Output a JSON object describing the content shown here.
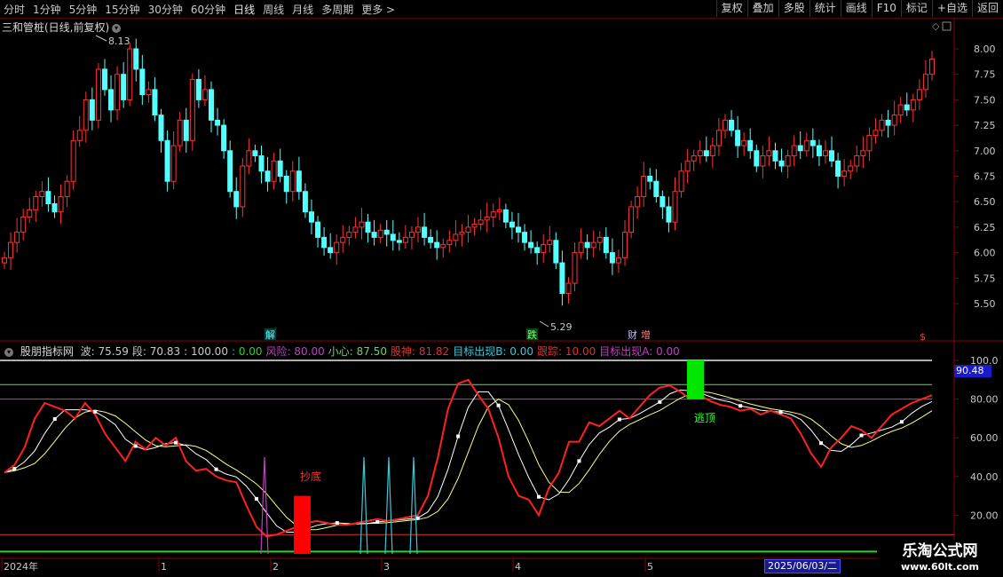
{
  "toolbar": {
    "periods": [
      "分时",
      "1分钟",
      "5分钟",
      "15分钟",
      "30分钟",
      "60分钟",
      "日线",
      "周线",
      "月线",
      "多周期",
      "更多 >"
    ],
    "active_period": "日线",
    "tools": [
      "复权",
      "叠加",
      "多股",
      "统计",
      "画线",
      "F10",
      "标记",
      "+自选",
      "返回"
    ]
  },
  "chart": {
    "stock_title": "三和管桩(日线,前复权)",
    "high_label": "8.13",
    "low_label": "5.29",
    "price_ticks": [
      "8.00",
      "7.75",
      "7.50",
      "7.25",
      "7.00",
      "6.75",
      "6.50",
      "6.25",
      "6.00",
      "5.75",
      "5.50"
    ],
    "price_range": [
      5.29,
      8.13
    ],
    "markers": [
      "解",
      "跌",
      "财",
      "增",
      "$"
    ]
  },
  "indicator": {
    "name": "股朋指标网",
    "values": [
      {
        "label": "波:",
        "value": "75.59",
        "color": "#c8c8c8"
      },
      {
        "label": "段:",
        "value": "70.83",
        "color": "#c8c8c8"
      },
      {
        "label": ":",
        "value": "100.00",
        "color": "#c8c8c8"
      },
      {
        "label": ":",
        "value": "0.00",
        "color": "#27d427"
      },
      {
        "label": "风险:",
        "value": "80.00",
        "color": "#c040c0"
      },
      {
        "label": "小心:",
        "value": "87.50",
        "color": "#6ad36a"
      },
      {
        "label": "股神:",
        "value": "81.82",
        "color": "#e03030"
      },
      {
        "label": "目标出现B:",
        "value": "0.00",
        "color": "#38c8d8"
      },
      {
        "label": "跟踪:",
        "value": "10.00",
        "color": "#e03030"
      },
      {
        "label": "目标出现A:",
        "value": "0.00",
        "color": "#c040c0"
      }
    ],
    "y_ticks": [
      "100.0",
      "80.00",
      "60.00",
      "40.00",
      "20.00"
    ],
    "current_badge": "90.48",
    "signal_buy": "抄底",
    "signal_sell": "逃顶"
  },
  "timeline": {
    "labels": [
      "2024年",
      "1",
      "2",
      "3",
      "4",
      "5"
    ],
    "current_date": "2025/06/03/二"
  },
  "watermark": {
    "line1": "乐淘公式网",
    "line2": "www.60lt.com"
  },
  "colors": {
    "up": "#ff3232",
    "down": "#54ffff",
    "ma_white": "#ffffff",
    "ma_yellow": "#ffff88"
  }
}
